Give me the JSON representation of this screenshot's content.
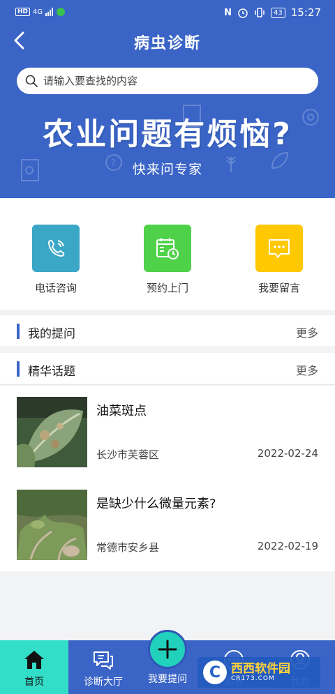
{
  "status_bar": {
    "hd": "HD",
    "network": "4G",
    "battery": "43",
    "time": "15:27"
  },
  "header": {
    "title": "病虫诊断"
  },
  "search": {
    "placeholder": "请输入要查找的内容"
  },
  "banner": {
    "title": "农业问题有烦恼?",
    "subtitle": "快来问专家"
  },
  "actions": [
    {
      "label": "电话咨询",
      "icon": "phone-icon",
      "color": "#3aa7c6"
    },
    {
      "label": "预约上门",
      "icon": "calendar-icon",
      "color": "#4fd24a"
    },
    {
      "label": "我要留言",
      "icon": "message-icon",
      "color": "#ffc800"
    }
  ],
  "sections": {
    "my_questions": {
      "title": "我的提问",
      "more": "更多"
    },
    "featured": {
      "title": "精华话题",
      "more": "更多"
    }
  },
  "topics": [
    {
      "title": "油菜斑点",
      "location": "长沙市芙蓉区",
      "date": "2022-02-24"
    },
    {
      "title": "是缺少什么微量元素?",
      "location": "常德市安乡县",
      "date": "2022-02-19"
    }
  ],
  "tabbar": {
    "home": "首页",
    "hall": "诊断大厅",
    "ask": "我要提问",
    "messages": "消息",
    "mine": "我的"
  },
  "watermark": {
    "logo": "C",
    "name": "西西软件园",
    "url": "CR173.COM"
  },
  "colors": {
    "primary": "#3a64c6",
    "active_tab": "#33dec9",
    "fab": "#22d1bb"
  }
}
